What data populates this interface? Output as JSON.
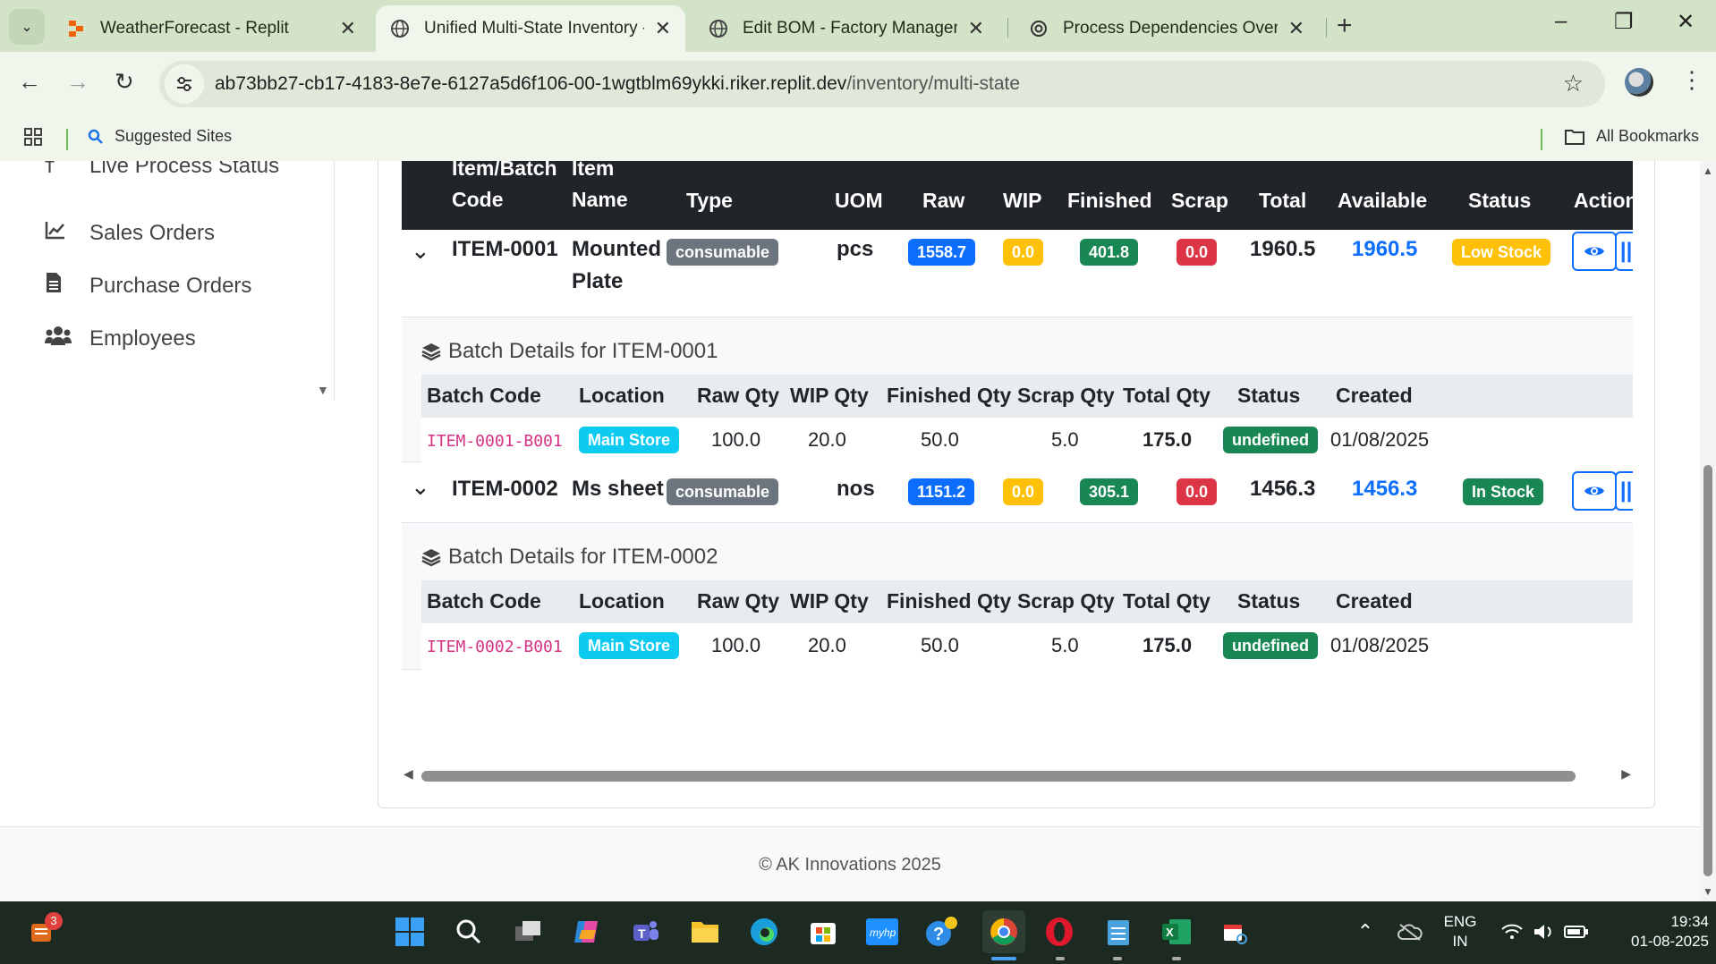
{
  "browser": {
    "tabs": [
      {
        "title": "WeatherForecast - Replit",
        "active": false
      },
      {
        "title": "Unified Multi-State Inventory - A",
        "active": true
      },
      {
        "title": "Edit BOM - Factory Management",
        "active": false
      },
      {
        "title": "Process Dependencies Overview",
        "active": false
      }
    ],
    "url_host": "ab73bb27-cb17-4183-8e7e-6127a5d6f106-00-1wgtblm69ykki.riker.replit.dev",
    "url_path": "/inventory/multi-state",
    "bookmarks": {
      "suggested": "Suggested Sites",
      "all": "All Bookmarks"
    }
  },
  "sidebar": {
    "items": [
      {
        "label": "Live Process Status",
        "icon": "broadcast-tower-icon"
      },
      {
        "label": "Sales Orders",
        "icon": "line-chart-icon"
      },
      {
        "label": "Purchase Orders",
        "icon": "document-icon"
      },
      {
        "label": "Employees",
        "icon": "users-icon"
      }
    ]
  },
  "table": {
    "headers": {
      "code_line1": "Item/Batch",
      "code_line2": "Code",
      "name_line1": "Item",
      "name_line2": "Name",
      "type": "Type",
      "uom": "UOM",
      "raw": "Raw",
      "wip": "WIP",
      "finished": "Finished",
      "scrap": "Scrap",
      "total": "Total",
      "available": "Available",
      "status": "Status",
      "actions": "Actions"
    },
    "items": [
      {
        "code": "ITEM-0001",
        "name_line1": "Mounted",
        "name_line2": "Plate",
        "type": "consumable",
        "uom": "pcs",
        "raw": "1558.7",
        "wip": "0.0",
        "finished": "401.8",
        "scrap": "0.0",
        "total": "1960.5",
        "available": "1960.5",
        "status": "Low Stock",
        "batch_title": "Batch Details for ITEM-0001",
        "batch": {
          "code": "ITEM-0001-B001",
          "location": "Main Store",
          "raw": "100.0",
          "wip": "20.0",
          "finished": "50.0",
          "scrap": "5.0",
          "total": "175.0",
          "status": "undefined",
          "created": "01/08/2025"
        }
      },
      {
        "code": "ITEM-0002",
        "name_line1": "Ms sheet",
        "name_line2": "",
        "type": "consumable",
        "uom": "nos",
        "raw": "1151.2",
        "wip": "0.0",
        "finished": "305.1",
        "scrap": "0.0",
        "total": "1456.3",
        "available": "1456.3",
        "status": "In Stock",
        "batch_title": "Batch Details for ITEM-0002",
        "batch": {
          "code": "ITEM-0002-B001",
          "location": "Main Store",
          "raw": "100.0",
          "wip": "20.0",
          "finished": "50.0",
          "scrap": "5.0",
          "total": "175.0",
          "status": "undefined",
          "created": "01/08/2025"
        }
      }
    ],
    "batch_headers": {
      "code": "Batch Code",
      "location": "Location",
      "raw": "Raw Qty",
      "wip": "WIP Qty",
      "finished": "Finished Qty",
      "scrap": "Scrap Qty",
      "total": "Total Qty",
      "status": "Status",
      "created": "Created"
    }
  },
  "footer": {
    "text": "© AK Innovations 2025"
  },
  "taskbar": {
    "notification_count": "3",
    "lang_line1": "ENG",
    "lang_line2": "IN",
    "time": "19:34",
    "date": "01-08-2025"
  },
  "colors": {
    "primary": "#0d6efd",
    "success": "#198754",
    "warning": "#ffc107",
    "danger": "#dc3545",
    "info": "#0dcaf0",
    "secondary": "#6c757d",
    "chrome": "#d3e3c8"
  }
}
